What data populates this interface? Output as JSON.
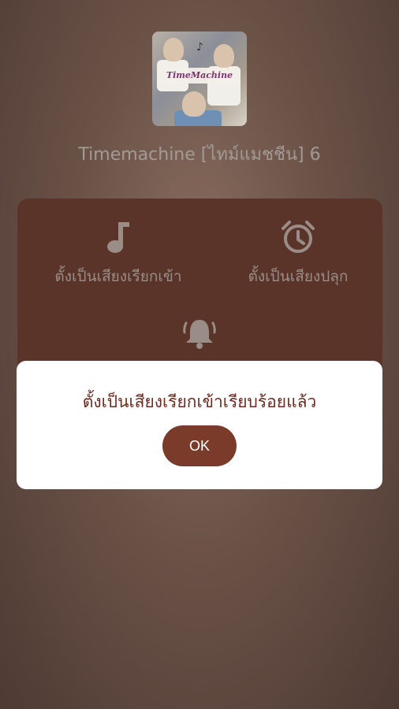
{
  "song": {
    "title": "Timemachine [ไทม์แมชชีน] 6",
    "cover_text": "TimeMachine"
  },
  "options": {
    "ringtone": {
      "label": "ตั้งเป็นเสียงเรียกเข้า",
      "icon": "music-note-icon"
    },
    "alarm": {
      "label": "ตั้งเป็นเสียงปลุก",
      "icon": "alarm-clock-icon"
    },
    "notification": {
      "label": "",
      "icon": "bell-icon"
    }
  },
  "dialog": {
    "message": "ตั้งเป็นเสียงเรียกเข้าเรียบร้อยแล้ว",
    "ok_label": "OK"
  },
  "colors": {
    "background": "#6b5247",
    "panel": "#5a3429",
    "dialog_text": "#6e2a1f",
    "ok_button": "#7b3b2b"
  }
}
